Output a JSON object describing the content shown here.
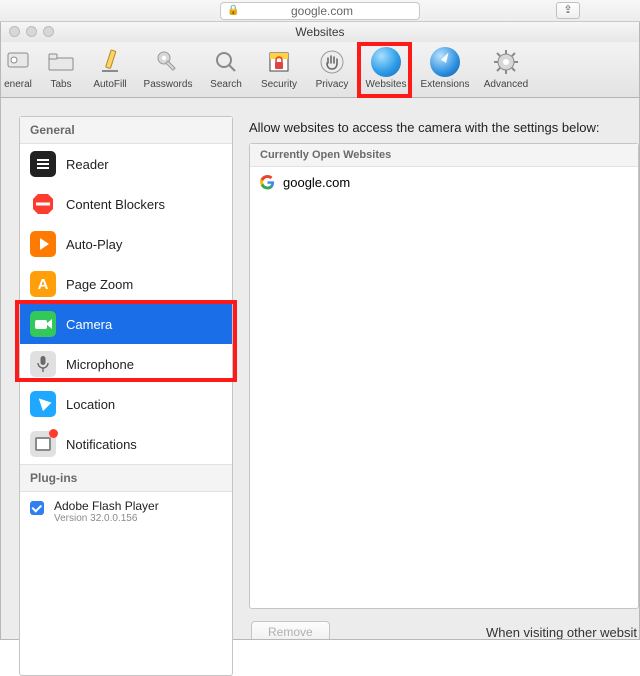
{
  "address_bar": {
    "url": "google.com",
    "share_glyph": "⇪"
  },
  "window": {
    "title": "Websites"
  },
  "toolbar": [
    {
      "key": "general",
      "label": "eneral"
    },
    {
      "key": "tabs",
      "label": "Tabs"
    },
    {
      "key": "autofill",
      "label": "AutoFill"
    },
    {
      "key": "passwords",
      "label": "Passwords"
    },
    {
      "key": "search",
      "label": "Search"
    },
    {
      "key": "security",
      "label": "Security"
    },
    {
      "key": "privacy",
      "label": "Privacy"
    },
    {
      "key": "websites",
      "label": "Websites",
      "selected": true,
      "highlighted": true
    },
    {
      "key": "extensions",
      "label": "Extensions"
    },
    {
      "key": "advanced",
      "label": "Advanced"
    }
  ],
  "sidebar": {
    "sections": {
      "general_header": "General",
      "plugins_header": "Plug-ins"
    },
    "items": [
      {
        "key": "reader",
        "label": "Reader"
      },
      {
        "key": "blockers",
        "label": "Content Blockers"
      },
      {
        "key": "autoplay",
        "label": "Auto-Play"
      },
      {
        "key": "pagezoom",
        "label": "Page Zoom"
      },
      {
        "key": "camera",
        "label": "Camera",
        "selected": true,
        "highlighted": true
      },
      {
        "key": "mic",
        "label": "Microphone",
        "highlighted": true
      },
      {
        "key": "location",
        "label": "Location"
      },
      {
        "key": "notif",
        "label": "Notifications"
      }
    ],
    "plugins": [
      {
        "name": "Adobe Flash Player",
        "version": "Version 32.0.0.156",
        "checked": true
      }
    ]
  },
  "main": {
    "heading": "Allow websites to access the camera with the settings below:",
    "list_header": "Currently Open Websites",
    "rows": [
      {
        "site": "google.com"
      }
    ],
    "footer": {
      "remove_label": "Remove",
      "hint": "When visiting other websit"
    }
  }
}
